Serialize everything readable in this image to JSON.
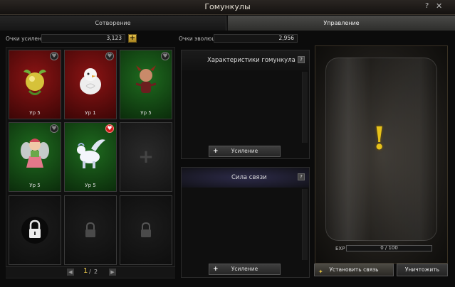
{
  "window": {
    "title": "Гомункулы",
    "help": "?",
    "close": "✕"
  },
  "tabs": [
    {
      "label": "Сотворение"
    },
    {
      "label": "Управление"
    }
  ],
  "stats": {
    "boost_label": "Очки усиления",
    "boost_value": "3,123",
    "evo_label": "Очки эволюции",
    "evo_value": "2,956",
    "add": "+"
  },
  "slots": [
    {
      "level": "Ур 5",
      "bg": "red",
      "icon": "yellow-seed-pet-icon"
    },
    {
      "level": "Ур 1",
      "bg": "red",
      "icon": "white-chick-pet-icon"
    },
    {
      "level": "Ур 5",
      "bg": "green",
      "icon": "imp-pet-icon"
    },
    {
      "level": "Ур 5",
      "bg": "green",
      "icon": "fairy-pet-icon"
    },
    {
      "level": "Ур 5",
      "bg": "green",
      "icon": "winged-horse-pet-icon",
      "favorite": true
    },
    {
      "type": "add",
      "glyph": "+"
    },
    {
      "type": "locked"
    },
    {
      "type": "locked"
    },
    {
      "type": "locked"
    }
  ],
  "pager": {
    "current": "1",
    "separator": "/",
    "total": "2",
    "prev": "◀",
    "next": "▶"
  },
  "panels": {
    "characteristics": {
      "title": "Характеристики гомункула",
      "help": "?",
      "button": "Усиление",
      "button_icon": "+"
    },
    "bond": {
      "title": "Сила связи",
      "help": "?",
      "button": "Усиление",
      "button_icon": "+"
    }
  },
  "preview": {
    "symbol": "!",
    "exp_label": "EXP",
    "exp_value": "0 / 100",
    "exp_progress": 0
  },
  "actions": {
    "link": "Установить связь",
    "destroy": "Уничтожить"
  },
  "colors": {
    "accent": "#e7c21a",
    "slot_red": "#8c1414",
    "slot_green": "#1f6b1f"
  }
}
